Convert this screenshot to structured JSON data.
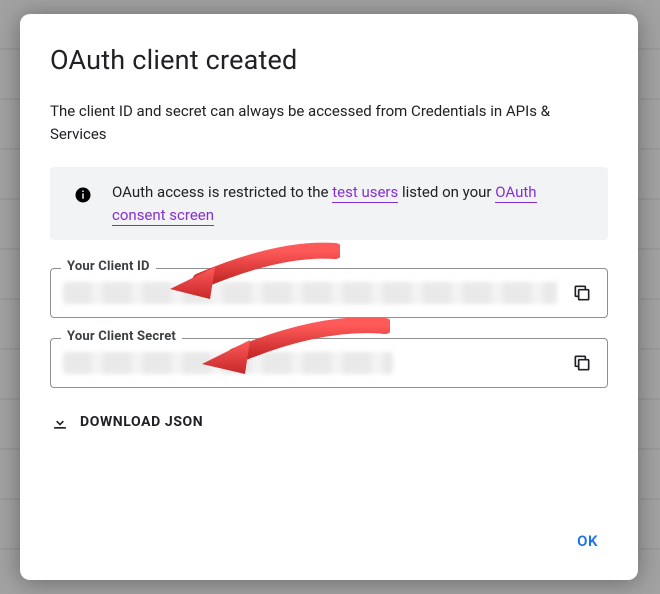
{
  "title": "OAuth client created",
  "subtitle": "The client ID and secret can always be accessed from Credentials in APIs & Services",
  "info_banner": {
    "prefix": "OAuth access is restricted to the ",
    "link1_text": "test users",
    "middle": " listed on your ",
    "link2_text": "OAuth consent screen"
  },
  "fields": {
    "client_id_label": "Your Client ID",
    "client_secret_label": "Your Client Secret"
  },
  "download_label": "DOWNLOAD JSON",
  "ok_label": "OK"
}
